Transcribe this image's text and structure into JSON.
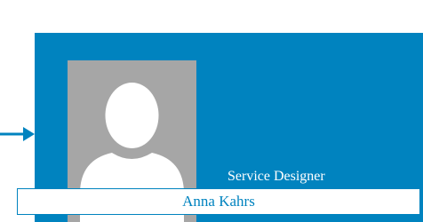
{
  "card": {
    "role": "Service Designer",
    "name": "Anna Kahrs",
    "photo_icon": "person-silhouette",
    "colors": {
      "card_background": "#0083bf",
      "photo_background": "#a6a6a6",
      "silhouette": "#ffffff",
      "name_text": "#0083bf",
      "connector": "#0083bf"
    }
  },
  "connector": {
    "icon": "arrow-right"
  }
}
